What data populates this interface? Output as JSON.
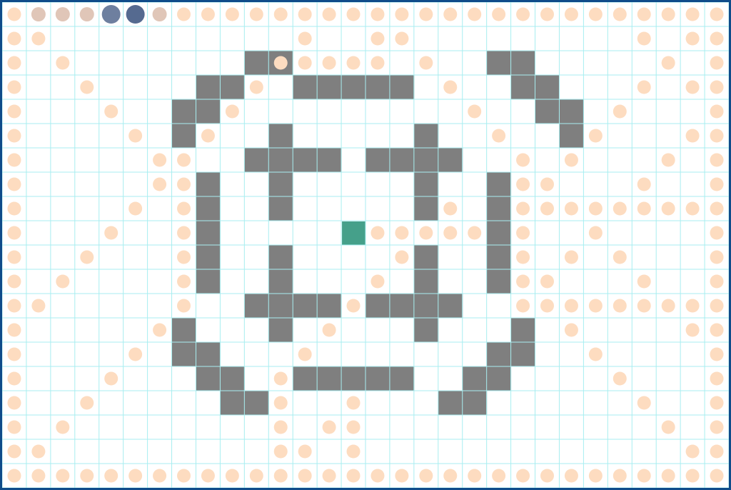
{
  "game": {
    "grid": {
      "cols": 30,
      "rows": 20
    },
    "colors": {
      "background": "#ffffff",
      "grid_line": "#a8eef0",
      "wall": "#7f7f7f",
      "pellet": "#fddcc0",
      "player": "#45a08a",
      "trail_head": "#556a90",
      "trail_mid": "#6e7f9f",
      "trail_tail": "#e0c6b8",
      "border": "#0f4c8a"
    },
    "player": {
      "col": 14,
      "row": 9
    },
    "trail": [
      {
        "col": 1,
        "row": 0,
        "kind": "tail"
      },
      {
        "col": 2,
        "row": 0,
        "kind": "tail"
      },
      {
        "col": 3,
        "row": 0,
        "kind": "tail"
      },
      {
        "col": 4,
        "row": 0,
        "kind": "mid"
      },
      {
        "col": 5,
        "row": 0,
        "kind": "head"
      },
      {
        "col": 6,
        "row": 0,
        "kind": "tail"
      }
    ],
    "walls": [
      [
        10,
        2
      ],
      [
        11,
        2
      ],
      [
        20,
        2
      ],
      [
        21,
        2
      ],
      [
        8,
        3
      ],
      [
        9,
        3
      ],
      [
        12,
        3
      ],
      [
        13,
        3
      ],
      [
        14,
        3
      ],
      [
        15,
        3
      ],
      [
        16,
        3
      ],
      [
        21,
        3
      ],
      [
        22,
        3
      ],
      [
        7,
        4
      ],
      [
        8,
        4
      ],
      [
        22,
        4
      ],
      [
        23,
        4
      ],
      [
        7,
        5
      ],
      [
        11,
        5
      ],
      [
        17,
        5
      ],
      [
        23,
        5
      ],
      [
        10,
        6
      ],
      [
        11,
        6
      ],
      [
        12,
        6
      ],
      [
        13,
        6
      ],
      [
        15,
        6
      ],
      [
        16,
        6
      ],
      [
        17,
        6
      ],
      [
        18,
        6
      ],
      [
        8,
        7
      ],
      [
        11,
        7
      ],
      [
        17,
        7
      ],
      [
        20,
        7
      ],
      [
        8,
        8
      ],
      [
        11,
        8
      ],
      [
        17,
        8
      ],
      [
        20,
        8
      ],
      [
        8,
        9
      ],
      [
        20,
        9
      ],
      [
        8,
        10
      ],
      [
        11,
        10
      ],
      [
        17,
        10
      ],
      [
        20,
        10
      ],
      [
        8,
        11
      ],
      [
        11,
        11
      ],
      [
        17,
        11
      ],
      [
        20,
        11
      ],
      [
        10,
        12
      ],
      [
        11,
        12
      ],
      [
        12,
        12
      ],
      [
        13,
        12
      ],
      [
        15,
        12
      ],
      [
        16,
        12
      ],
      [
        17,
        12
      ],
      [
        18,
        12
      ],
      [
        7,
        13
      ],
      [
        11,
        13
      ],
      [
        17,
        13
      ],
      [
        21,
        13
      ],
      [
        7,
        14
      ],
      [
        8,
        14
      ],
      [
        20,
        14
      ],
      [
        21,
        14
      ],
      [
        8,
        15
      ],
      [
        9,
        15
      ],
      [
        12,
        15
      ],
      [
        13,
        15
      ],
      [
        14,
        15
      ],
      [
        15,
        15
      ],
      [
        16,
        15
      ],
      [
        19,
        15
      ],
      [
        20,
        15
      ],
      [
        9,
        16
      ],
      [
        10,
        16
      ],
      [
        18,
        16
      ],
      [
        19,
        16
      ]
    ],
    "pellets": [
      [
        0,
        0
      ],
      [
        7,
        0
      ],
      [
        8,
        0
      ],
      [
        9,
        0
      ],
      [
        10,
        0
      ],
      [
        11,
        0
      ],
      [
        12,
        0
      ],
      [
        13,
        0
      ],
      [
        14,
        0
      ],
      [
        15,
        0
      ],
      [
        16,
        0
      ],
      [
        17,
        0
      ],
      [
        18,
        0
      ],
      [
        19,
        0
      ],
      [
        20,
        0
      ],
      [
        21,
        0
      ],
      [
        22,
        0
      ],
      [
        23,
        0
      ],
      [
        24,
        0
      ],
      [
        25,
        0
      ],
      [
        26,
        0
      ],
      [
        27,
        0
      ],
      [
        28,
        0
      ],
      [
        29,
        0
      ],
      [
        0,
        1
      ],
      [
        1,
        1
      ],
      [
        12,
        1
      ],
      [
        15,
        1
      ],
      [
        16,
        1
      ],
      [
        26,
        1
      ],
      [
        28,
        1
      ],
      [
        29,
        1
      ],
      [
        0,
        2
      ],
      [
        2,
        2
      ],
      [
        11,
        2
      ],
      [
        12,
        2
      ],
      [
        13,
        2
      ],
      [
        14,
        2
      ],
      [
        15,
        2
      ],
      [
        17,
        2
      ],
      [
        27,
        2
      ],
      [
        29,
        2
      ],
      [
        0,
        3
      ],
      [
        3,
        3
      ],
      [
        10,
        3
      ],
      [
        18,
        3
      ],
      [
        26,
        3
      ],
      [
        28,
        3
      ],
      [
        29,
        3
      ],
      [
        0,
        4
      ],
      [
        4,
        4
      ],
      [
        9,
        4
      ],
      [
        19,
        4
      ],
      [
        25,
        4
      ],
      [
        29,
        4
      ],
      [
        0,
        5
      ],
      [
        5,
        5
      ],
      [
        8,
        5
      ],
      [
        20,
        5
      ],
      [
        24,
        5
      ],
      [
        28,
        5
      ],
      [
        29,
        5
      ],
      [
        0,
        6
      ],
      [
        6,
        6
      ],
      [
        7,
        6
      ],
      [
        21,
        6
      ],
      [
        23,
        6
      ],
      [
        27,
        6
      ],
      [
        29,
        6
      ],
      [
        0,
        7
      ],
      [
        6,
        7
      ],
      [
        7,
        7
      ],
      [
        21,
        7
      ],
      [
        22,
        7
      ],
      [
        26,
        7
      ],
      [
        29,
        7
      ],
      [
        0,
        8
      ],
      [
        5,
        8
      ],
      [
        7,
        8
      ],
      [
        18,
        8
      ],
      [
        21,
        8
      ],
      [
        22,
        8
      ],
      [
        23,
        8
      ],
      [
        24,
        8
      ],
      [
        25,
        8
      ],
      [
        26,
        8
      ],
      [
        27,
        8
      ],
      [
        28,
        8
      ],
      [
        29,
        8
      ],
      [
        0,
        9
      ],
      [
        4,
        9
      ],
      [
        7,
        9
      ],
      [
        15,
        9
      ],
      [
        16,
        9
      ],
      [
        17,
        9
      ],
      [
        18,
        9
      ],
      [
        19,
        9
      ],
      [
        21,
        9
      ],
      [
        24,
        9
      ],
      [
        29,
        9
      ],
      [
        0,
        10
      ],
      [
        3,
        10
      ],
      [
        7,
        10
      ],
      [
        16,
        10
      ],
      [
        21,
        10
      ],
      [
        23,
        10
      ],
      [
        25,
        10
      ],
      [
        29,
        10
      ],
      [
        0,
        11
      ],
      [
        2,
        11
      ],
      [
        7,
        11
      ],
      [
        15,
        11
      ],
      [
        21,
        11
      ],
      [
        22,
        11
      ],
      [
        26,
        11
      ],
      [
        29,
        11
      ],
      [
        0,
        12
      ],
      [
        1,
        12
      ],
      [
        7,
        12
      ],
      [
        14,
        12
      ],
      [
        21,
        12
      ],
      [
        22,
        12
      ],
      [
        23,
        12
      ],
      [
        24,
        12
      ],
      [
        25,
        12
      ],
      [
        26,
        12
      ],
      [
        27,
        12
      ],
      [
        28,
        12
      ],
      [
        29,
        12
      ],
      [
        0,
        13
      ],
      [
        6,
        13
      ],
      [
        13,
        13
      ],
      [
        23,
        13
      ],
      [
        28,
        13
      ],
      [
        29,
        13
      ],
      [
        0,
        14
      ],
      [
        5,
        14
      ],
      [
        12,
        14
      ],
      [
        24,
        14
      ],
      [
        29,
        14
      ],
      [
        0,
        15
      ],
      [
        4,
        15
      ],
      [
        11,
        15
      ],
      [
        25,
        15
      ],
      [
        29,
        15
      ],
      [
        0,
        16
      ],
      [
        3,
        16
      ],
      [
        11,
        16
      ],
      [
        14,
        16
      ],
      [
        26,
        16
      ],
      [
        29,
        16
      ],
      [
        0,
        17
      ],
      [
        2,
        17
      ],
      [
        11,
        17
      ],
      [
        13,
        17
      ],
      [
        14,
        17
      ],
      [
        27,
        17
      ],
      [
        29,
        17
      ],
      [
        0,
        18
      ],
      [
        1,
        18
      ],
      [
        11,
        18
      ],
      [
        12,
        18
      ],
      [
        14,
        18
      ],
      [
        28,
        18
      ],
      [
        29,
        18
      ],
      [
        0,
        19
      ],
      [
        1,
        19
      ],
      [
        2,
        19
      ],
      [
        3,
        19
      ],
      [
        4,
        19
      ],
      [
        5,
        19
      ],
      [
        6,
        19
      ],
      [
        7,
        19
      ],
      [
        8,
        19
      ],
      [
        9,
        19
      ],
      [
        10,
        19
      ],
      [
        11,
        19
      ],
      [
        12,
        19
      ],
      [
        13,
        19
      ],
      [
        14,
        19
      ],
      [
        15,
        19
      ],
      [
        16,
        19
      ],
      [
        17,
        19
      ],
      [
        18,
        19
      ],
      [
        19,
        19
      ],
      [
        20,
        19
      ],
      [
        21,
        19
      ],
      [
        22,
        19
      ],
      [
        23,
        19
      ],
      [
        24,
        19
      ],
      [
        25,
        19
      ],
      [
        26,
        19
      ],
      [
        27,
        19
      ],
      [
        28,
        19
      ],
      [
        29,
        19
      ]
    ]
  }
}
